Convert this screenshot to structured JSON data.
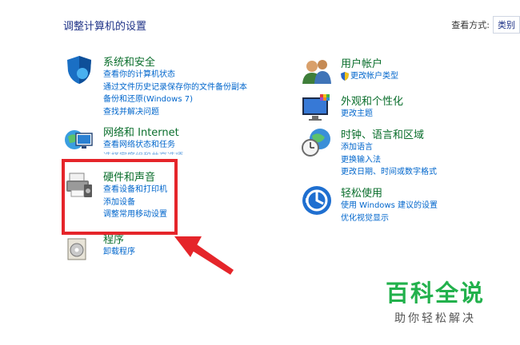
{
  "header": {
    "title": "调整计算机的设置",
    "view_by_label": "查看方式:",
    "view_by_value": "类别"
  },
  "left_column": [
    {
      "title": "系统和安全",
      "icon": "shield-icon",
      "links": [
        "查看你的计算机状态",
        "通过文件历史记录保存你的文件备份副本",
        "备份和还原(Windows 7)",
        "查找并解决问题"
      ]
    },
    {
      "title": "网络和 Internet",
      "icon": "network-globe-icon",
      "links": [
        "查看网络状态和任务"
      ]
    },
    {
      "title": "硬件和声音",
      "icon": "printer-icon",
      "links": [
        "查看设备和打印机",
        "添加设备",
        "调整常用移动设置"
      ]
    },
    {
      "title": "程序",
      "icon": "programs-disc-icon",
      "links": [
        "卸载程序"
      ]
    }
  ],
  "network_overflow_text": "选择家庭组和共享选项",
  "right_column": [
    {
      "title": "用户帐户",
      "icon": "users-icon",
      "links": [
        "更改帐户类型"
      ]
    },
    {
      "title": "外观和个性化",
      "icon": "monitor-palette-icon",
      "links": [
        "更改主题"
      ]
    },
    {
      "title": "时钟、语言和区域",
      "icon": "clock-globe-icon",
      "links": [
        "添加语言",
        "更换输入法",
        "更改日期、时间或数字格式"
      ]
    },
    {
      "title": "轻松使用",
      "icon": "ease-of-access-icon",
      "links": [
        "使用 Windows 建议的设置",
        "优化视觉显示"
      ]
    }
  ],
  "watermark": {
    "title": "百科全说",
    "subtitle": "助你轻松解决"
  },
  "colors": {
    "link": "#0066cc",
    "category_title": "#0a6e2c",
    "highlight": "#e5252a",
    "watermark": "#22b14c"
  }
}
